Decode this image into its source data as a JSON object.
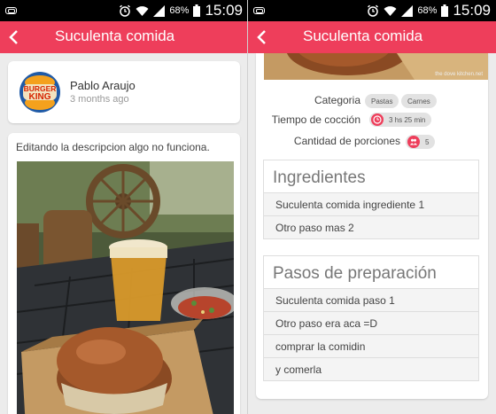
{
  "status": {
    "battery": "68%",
    "time": "15:09"
  },
  "appbar": {
    "title": "Suculenta comida"
  },
  "post": {
    "author": "Pablo Araujo",
    "time": "3 months ago",
    "logo_text_top": "BURGER",
    "logo_text_bottom": "KING",
    "description": "Editando la descripcion algo no funciona."
  },
  "details": {
    "watermark": "the dove kitchen.net",
    "category_label": "Categoria",
    "categories": [
      "Pastas",
      "Carnes"
    ],
    "cook_time_label": "Tiempo de cocción",
    "cook_time": "3 hs 25 min",
    "portions_label": "Cantidad de porciones",
    "portions": "5",
    "ingredients_title": "Ingredientes",
    "ingredients": [
      "Suculenta comida ingrediente 1",
      "Otro paso mas 2"
    ],
    "steps_title": "Pasos de preparación",
    "steps": [
      "Suculenta comida paso 1",
      "Otro paso era aca =D",
      "comprar la comidin",
      "y comerla"
    ]
  },
  "colors": {
    "accent": "#ee3e5b",
    "statusbar": "#000000",
    "background": "#ececec"
  }
}
